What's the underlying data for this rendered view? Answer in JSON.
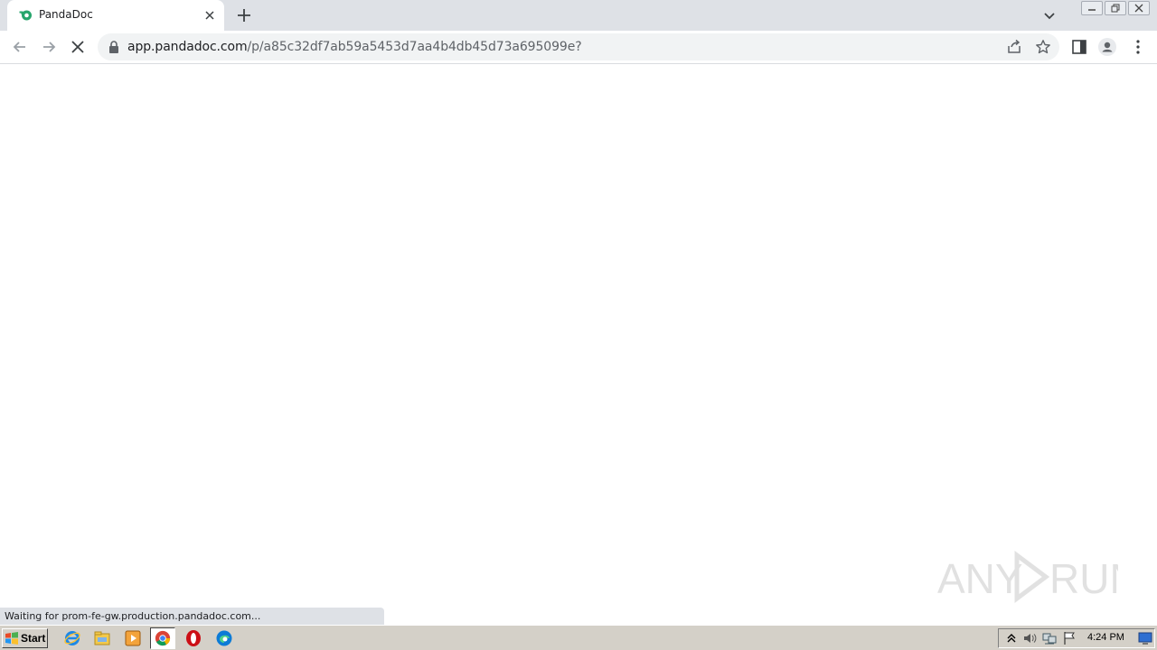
{
  "browser": {
    "tab": {
      "title": "PandaDoc",
      "favicon": "pandadoc-logo-icon"
    },
    "address_bar": {
      "host": "app.pandadoc.com",
      "path": "/p/a85c32df7ab59a5453d7aa4b4db45d73a695099e?"
    },
    "status_text": "Waiting for prom-fe-gw.production.pandadoc.com..."
  },
  "colors": {
    "tabstrip_bg": "#dee1e6",
    "omnibox_bg": "#f1f3f4",
    "taskbar_bg": "#d4d0c8",
    "pandadoc_green": "#26a56c"
  },
  "taskbar": {
    "start_label": "Start",
    "clock": "4:24 PM",
    "quick_launch": [
      "internet-explorer-icon",
      "file-explorer-icon",
      "media-player-icon",
      "chrome-icon",
      "opera-icon",
      "edge-icon"
    ],
    "tray": [
      "show-hidden-icons",
      "volume-icon",
      "network-icon",
      "action-center-flag-icon"
    ]
  },
  "watermark_text": "ANY RUN"
}
